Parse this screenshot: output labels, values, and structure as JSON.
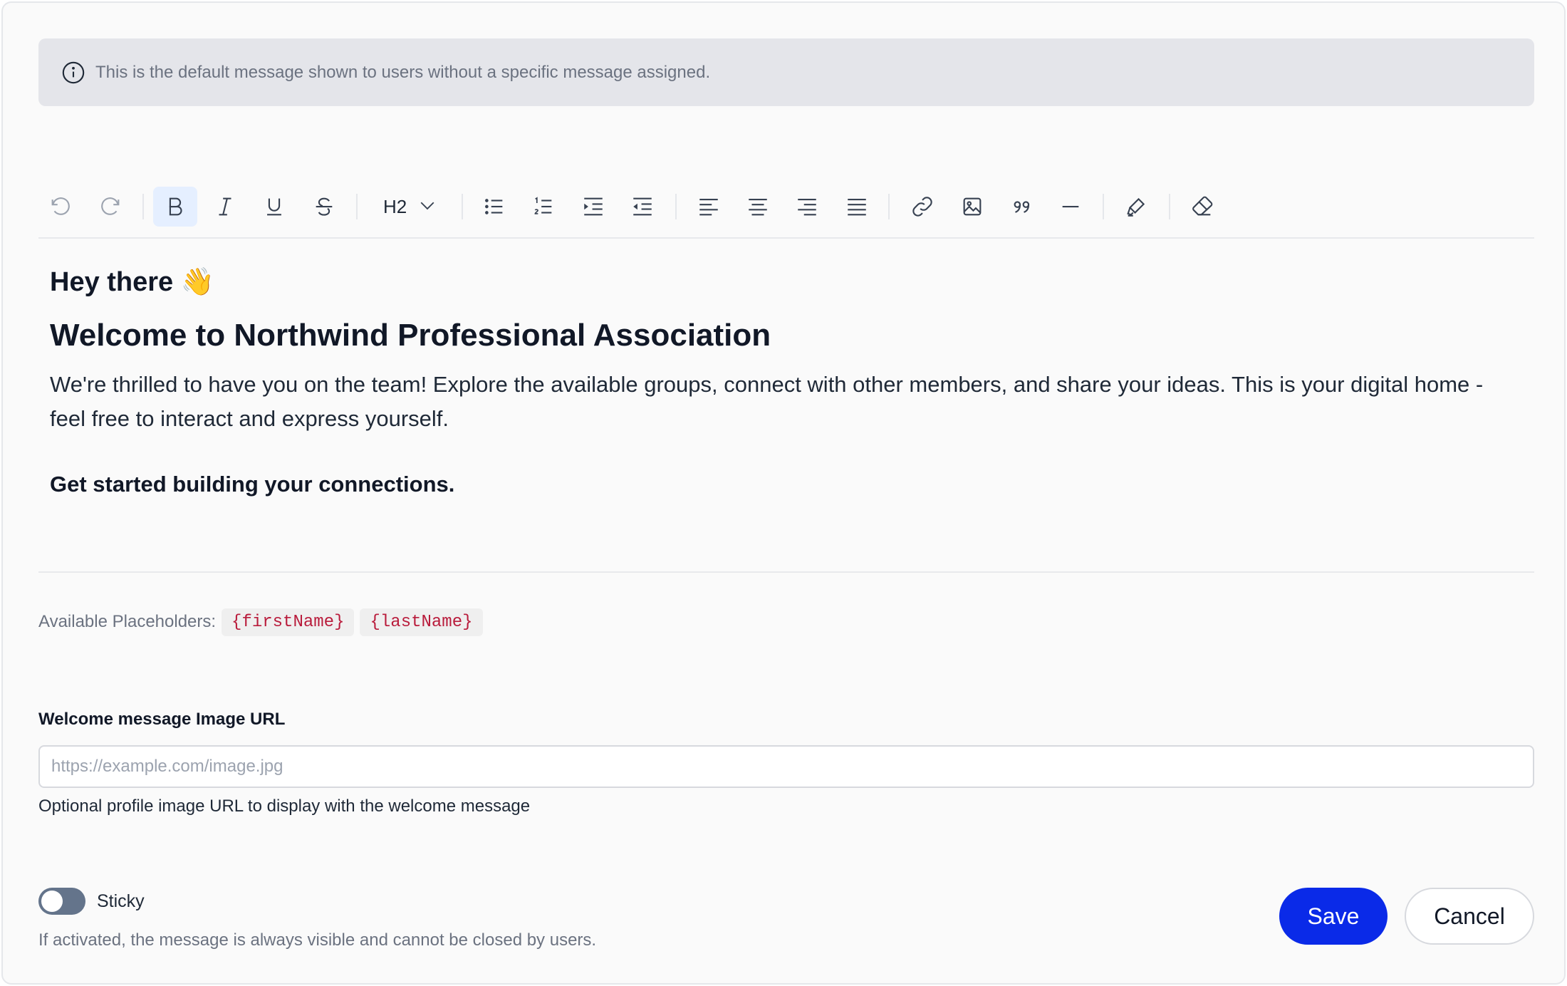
{
  "banner": {
    "icon": "info-icon",
    "text": "This is the default message shown to users without a specific message assigned."
  },
  "toolbar": {
    "heading_value": "H2",
    "buttons": [
      {
        "name": "undo-icon",
        "active": false
      },
      {
        "name": "redo-icon",
        "active": false
      },
      {
        "name": "bold-icon",
        "active": true
      },
      {
        "name": "italic-icon",
        "active": false
      },
      {
        "name": "underline-icon",
        "active": false
      },
      {
        "name": "strikethrough-icon",
        "active": false
      },
      {
        "name": "bullet-list-icon",
        "active": false
      },
      {
        "name": "ordered-list-icon",
        "active": false
      },
      {
        "name": "indent-icon",
        "active": false
      },
      {
        "name": "outdent-icon",
        "active": false
      },
      {
        "name": "align-left-icon",
        "active": false
      },
      {
        "name": "align-center-icon",
        "active": false
      },
      {
        "name": "align-right-icon",
        "active": false
      },
      {
        "name": "align-justify-icon",
        "active": false
      },
      {
        "name": "link-icon",
        "active": false
      },
      {
        "name": "image-icon",
        "active": false
      },
      {
        "name": "quote-icon",
        "active": false
      },
      {
        "name": "horizontal-rule-icon",
        "active": false
      },
      {
        "name": "highlighter-icon",
        "active": false
      },
      {
        "name": "eraser-icon",
        "active": false
      }
    ]
  },
  "editor": {
    "greeting": "Hey there 👋",
    "title": "Welcome to Northwind Professional Association",
    "paragraph": "We're thrilled to have you on the team! Explore the available groups, connect with other members, and share your ideas. This is your digital home - feel free to interact and express yourself.",
    "cta": "Get started building your connections."
  },
  "placeholders": {
    "label": "Available Placeholders:",
    "items": [
      "{firstName}",
      "{lastName}"
    ]
  },
  "image_url": {
    "label": "Welcome message Image URL",
    "placeholder": "https://example.com/image.jpg",
    "value": "",
    "help": "Optional profile image URL to display with the welcome message"
  },
  "sticky": {
    "label": "Sticky",
    "enabled": false,
    "help": "If activated, the message is always visible and cannot be closed by users."
  },
  "actions": {
    "save_label": "Save",
    "cancel_label": "Cancel"
  },
  "colors": {
    "primary": "#0a2ae8",
    "banner_bg": "#e4e5ea",
    "active_tool_bg": "#e5efff",
    "placeholder_chip_text": "#b91c3c",
    "toggle_off": "#64748b"
  }
}
